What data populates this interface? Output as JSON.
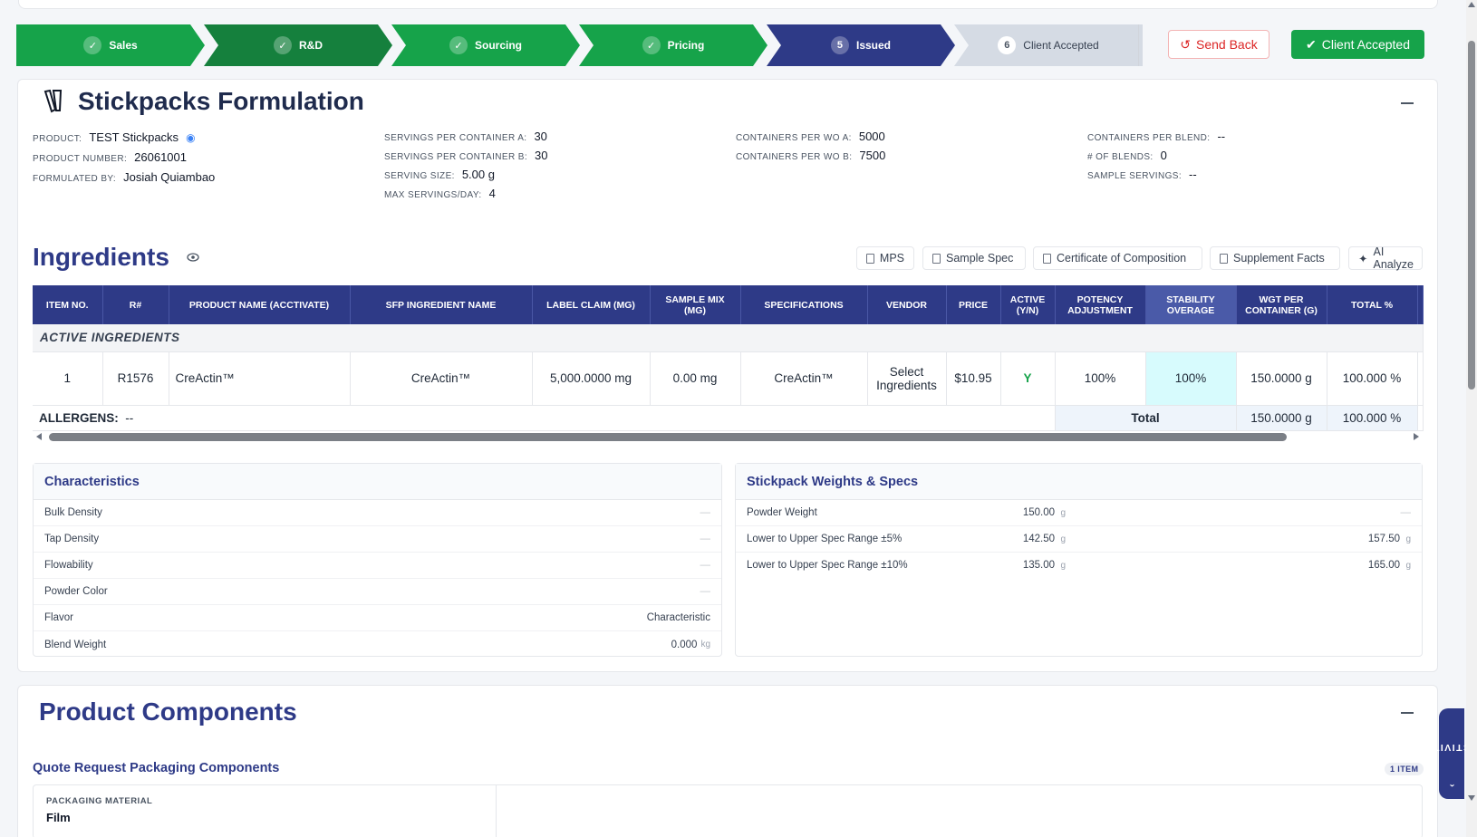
{
  "workflow": {
    "steps": [
      {
        "label": "Sales",
        "status": "done",
        "color": "#16a34a"
      },
      {
        "label": "R&D",
        "status": "done",
        "color": "#15803d"
      },
      {
        "label": "Sourcing",
        "status": "done",
        "color": "#16a34a"
      },
      {
        "label": "Pricing",
        "status": "done",
        "color": "#16a34a"
      },
      {
        "label": "Issued",
        "number": "5",
        "status": "current",
        "color": "#2e3a87"
      },
      {
        "label": "Client Accepted",
        "number": "6",
        "status": "pending",
        "color": "#d5dbe4"
      }
    ],
    "send_back": "Send Back",
    "client_accepted": "Client Accepted"
  },
  "formulation": {
    "title": "Stickpacks Formulation",
    "product_label": "PRODUCT:",
    "product": "TEST Stickpacks",
    "product_number_label": "PRODUCT NUMBER:",
    "product_number": "26061001",
    "formulated_by_label": "FORMULATED BY:",
    "formulated_by": "Josiah Quiambao",
    "servings_a_label": "SERVINGS PER CONTAINER A:",
    "servings_a": "30",
    "servings_b_label": "SERVINGS PER CONTAINER B:",
    "servings_b": "30",
    "serving_size_label": "SERVING SIZE:",
    "serving_size": "5.00 g",
    "max_servings_label": "MAX SERVINGS/DAY:",
    "max_servings": "4",
    "cont_wo_a_label": "CONTAINERS PER WO A:",
    "cont_wo_a": "5000",
    "cont_wo_b_label": "CONTAINERS PER WO B:",
    "cont_wo_b": "7500",
    "cont_blend_label": "CONTAINERS PER BLEND:",
    "cont_blend": "--",
    "blends_label": "# OF BLENDS:",
    "blends": "0",
    "sample_servings_label": "SAMPLE SERVINGS:",
    "sample_servings": "--"
  },
  "ingredients": {
    "title": "Ingredients",
    "buttons": {
      "mps": "MPS",
      "sample_spec": "Sample Spec",
      "coc": "Certificate of Composition",
      "supp_facts": "Supplement Facts",
      "ai": "AI Analyze"
    },
    "columns": [
      "ITEM NO.",
      "R#",
      "PRODUCT NAME (ACCTIVATE)",
      "SFP INGREDIENT NAME",
      "LABEL CLAIM (MG)",
      "SAMPLE MIX (MG)",
      "SPECIFICATIONS",
      "VENDOR",
      "PRICE",
      "ACTIVE (Y/N)",
      "POTENCY ADJUSTMENT",
      "STABILITY OVERAGE",
      "WGT PER CONTAINER (G)",
      "TOTAL %"
    ],
    "section": "ACTIVE INGREDIENTS",
    "rows": [
      {
        "item": "1",
        "r": "R1576",
        "product": "CreActin™",
        "sfp": "CreActin™",
        "claim": "5,000.0000 mg",
        "sample": "0.00 mg",
        "spec": "CreActin™",
        "vendor": "Select Ingredients",
        "price": "$10.95",
        "active": "Y",
        "potency": "100%",
        "stability": "100%",
        "wgt": "150.0000 g",
        "total": "100.000 %"
      }
    ],
    "allergens_label": "ALLERGENS:",
    "allergens": "--",
    "total_label": "Total",
    "total_wgt": "150.0000 g",
    "total_pct": "100.000 %"
  },
  "characteristics": {
    "title": "Characteristics",
    "rows": [
      {
        "label": "Bulk Density",
        "value": "—",
        "unit": ""
      },
      {
        "label": "Tap Density",
        "value": "—",
        "unit": ""
      },
      {
        "label": "Flowability",
        "value": "—",
        "unit": ""
      },
      {
        "label": "Powder Color",
        "value": "—",
        "unit": ""
      },
      {
        "label": "Flavor",
        "value": "Characteristic",
        "unit": ""
      },
      {
        "label": "Blend Weight",
        "value": "0.000",
        "unit": "kg"
      }
    ]
  },
  "weights": {
    "title": "Stickpack Weights & Specs",
    "rows": [
      {
        "label": "Powder Weight",
        "low": "150.00",
        "low_unit": "g",
        "high": "—",
        "high_unit": ""
      },
      {
        "label": "Lower to Upper Spec Range ±5%",
        "low": "142.50",
        "low_unit": "g",
        "high": "157.50",
        "high_unit": "g"
      },
      {
        "label": "Lower to Upper Spec Range ±10%",
        "low": "135.00",
        "low_unit": "g",
        "high": "165.00",
        "high_unit": "g"
      }
    ]
  },
  "components": {
    "title": "Product Components",
    "quote_title": "Quote Request Packaging Components",
    "item_badge": "1 ITEM",
    "packaging_label": "PACKAGING MATERIAL",
    "packaging_value": "Film"
  },
  "activity": "ACTIVITY"
}
